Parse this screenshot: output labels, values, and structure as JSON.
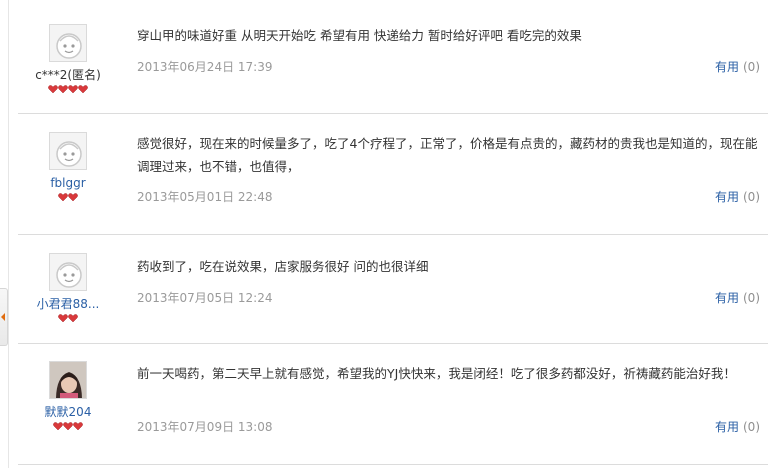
{
  "reviews": [
    {
      "username": "c***2(匿名)",
      "hearts": 4,
      "content": "穿山甲的味道好重 从明天开始吃 希望有用 快递给力 暂时给好评吧 看吃完的效果",
      "date": "2013年06月24日 17:39",
      "useful_label": "有用",
      "useful_count": "(0)"
    },
    {
      "username": "fblggr",
      "hearts": 2,
      "content": "感觉很好，现在来的时候量多了，吃了4个疗程了，正常了，价格是有点贵的，藏药材的贵我也是知道的，现在能调理过来，也不错，也值得，",
      "date": "2013年05月01日 22:48",
      "useful_label": "有用",
      "useful_count": "(0)"
    },
    {
      "username": "小君君88...",
      "hearts": 2,
      "content": "药收到了，吃在说效果，店家服务很好 问的也很详细",
      "date": "2013年07月05日 12:24",
      "useful_label": "有用",
      "useful_count": "(0)"
    },
    {
      "username": "默默204",
      "hearts": 3,
      "content": "前一天喝药，第二天早上就有感觉，希望我的YJ快快来，我是闭经！吃了很多药都没好，祈祷藏药能治好我！",
      "date": "2013年07月09日 13:08",
      "useful_label": "有用",
      "useful_count": "(0)"
    }
  ],
  "colors": {
    "link": "#2a5fa5",
    "date": "#9a9a9a",
    "heart": "#d9393b",
    "side_tab_arrow": "#e06c0f"
  },
  "icons": {
    "default_avatar": "default-avatar-icon",
    "photo_avatar": "user-photo-avatar",
    "rank": "heart-rank-icon",
    "side_tab": "collapse-arrow-icon"
  }
}
